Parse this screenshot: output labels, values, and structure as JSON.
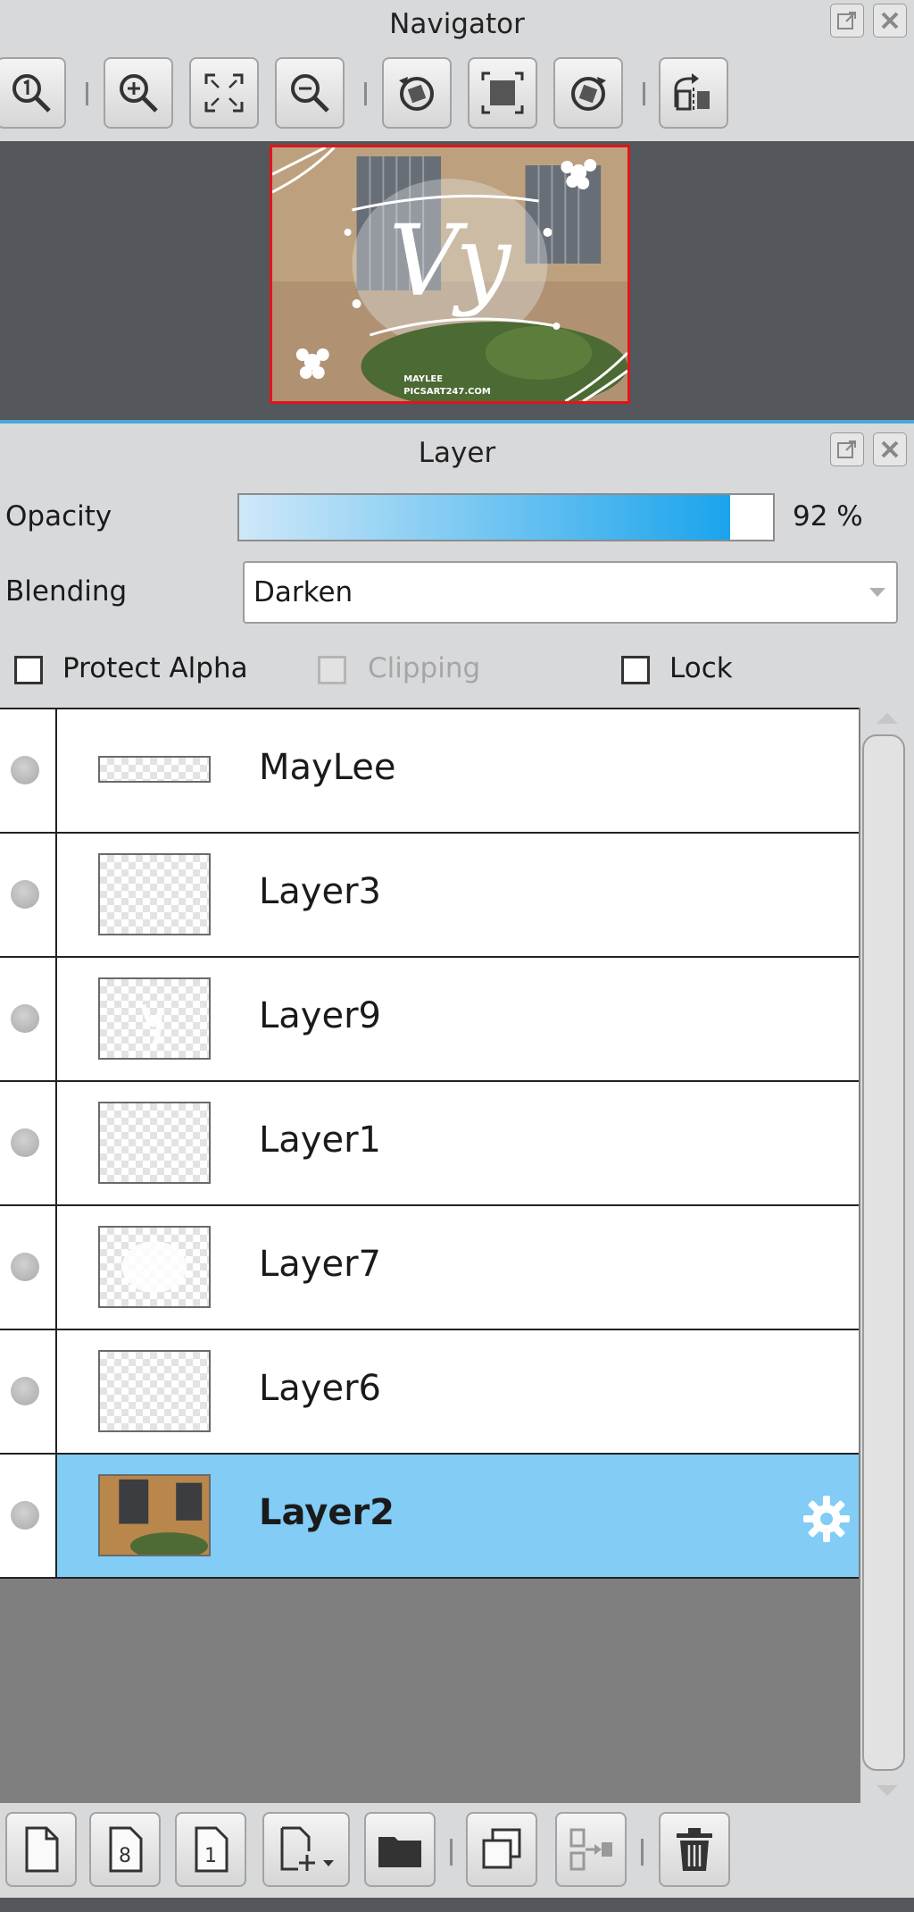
{
  "navigator": {
    "title": "Navigator",
    "thumbnail": {
      "text": "Vy",
      "watermark_line1": "MAYLEE",
      "watermark_line2": "PICSART247.COM"
    }
  },
  "layer_panel": {
    "title": "Layer",
    "opacity": {
      "label": "Opacity",
      "value": 92,
      "display": "92 %"
    },
    "blending": {
      "label": "Blending",
      "value": "Darken"
    },
    "checkboxes": [
      {
        "label": "Protect Alpha",
        "checked": false,
        "enabled": true
      },
      {
        "label": "Clipping",
        "checked": false,
        "enabled": false
      },
      {
        "label": "Lock",
        "checked": false,
        "enabled": true
      }
    ],
    "layers": [
      {
        "name": "MayLee",
        "selected": false
      },
      {
        "name": "Layer3",
        "selected": false
      },
      {
        "name": "Layer9",
        "selected": false
      },
      {
        "name": "Layer1",
        "selected": false
      },
      {
        "name": "Layer7",
        "selected": false
      },
      {
        "name": "Layer6",
        "selected": false
      },
      {
        "name": "Layer2",
        "selected": true
      }
    ]
  },
  "colors": {
    "accent": "#1aa4ec",
    "selection": "#82ccf5",
    "nav_frame": "#e0161b"
  }
}
